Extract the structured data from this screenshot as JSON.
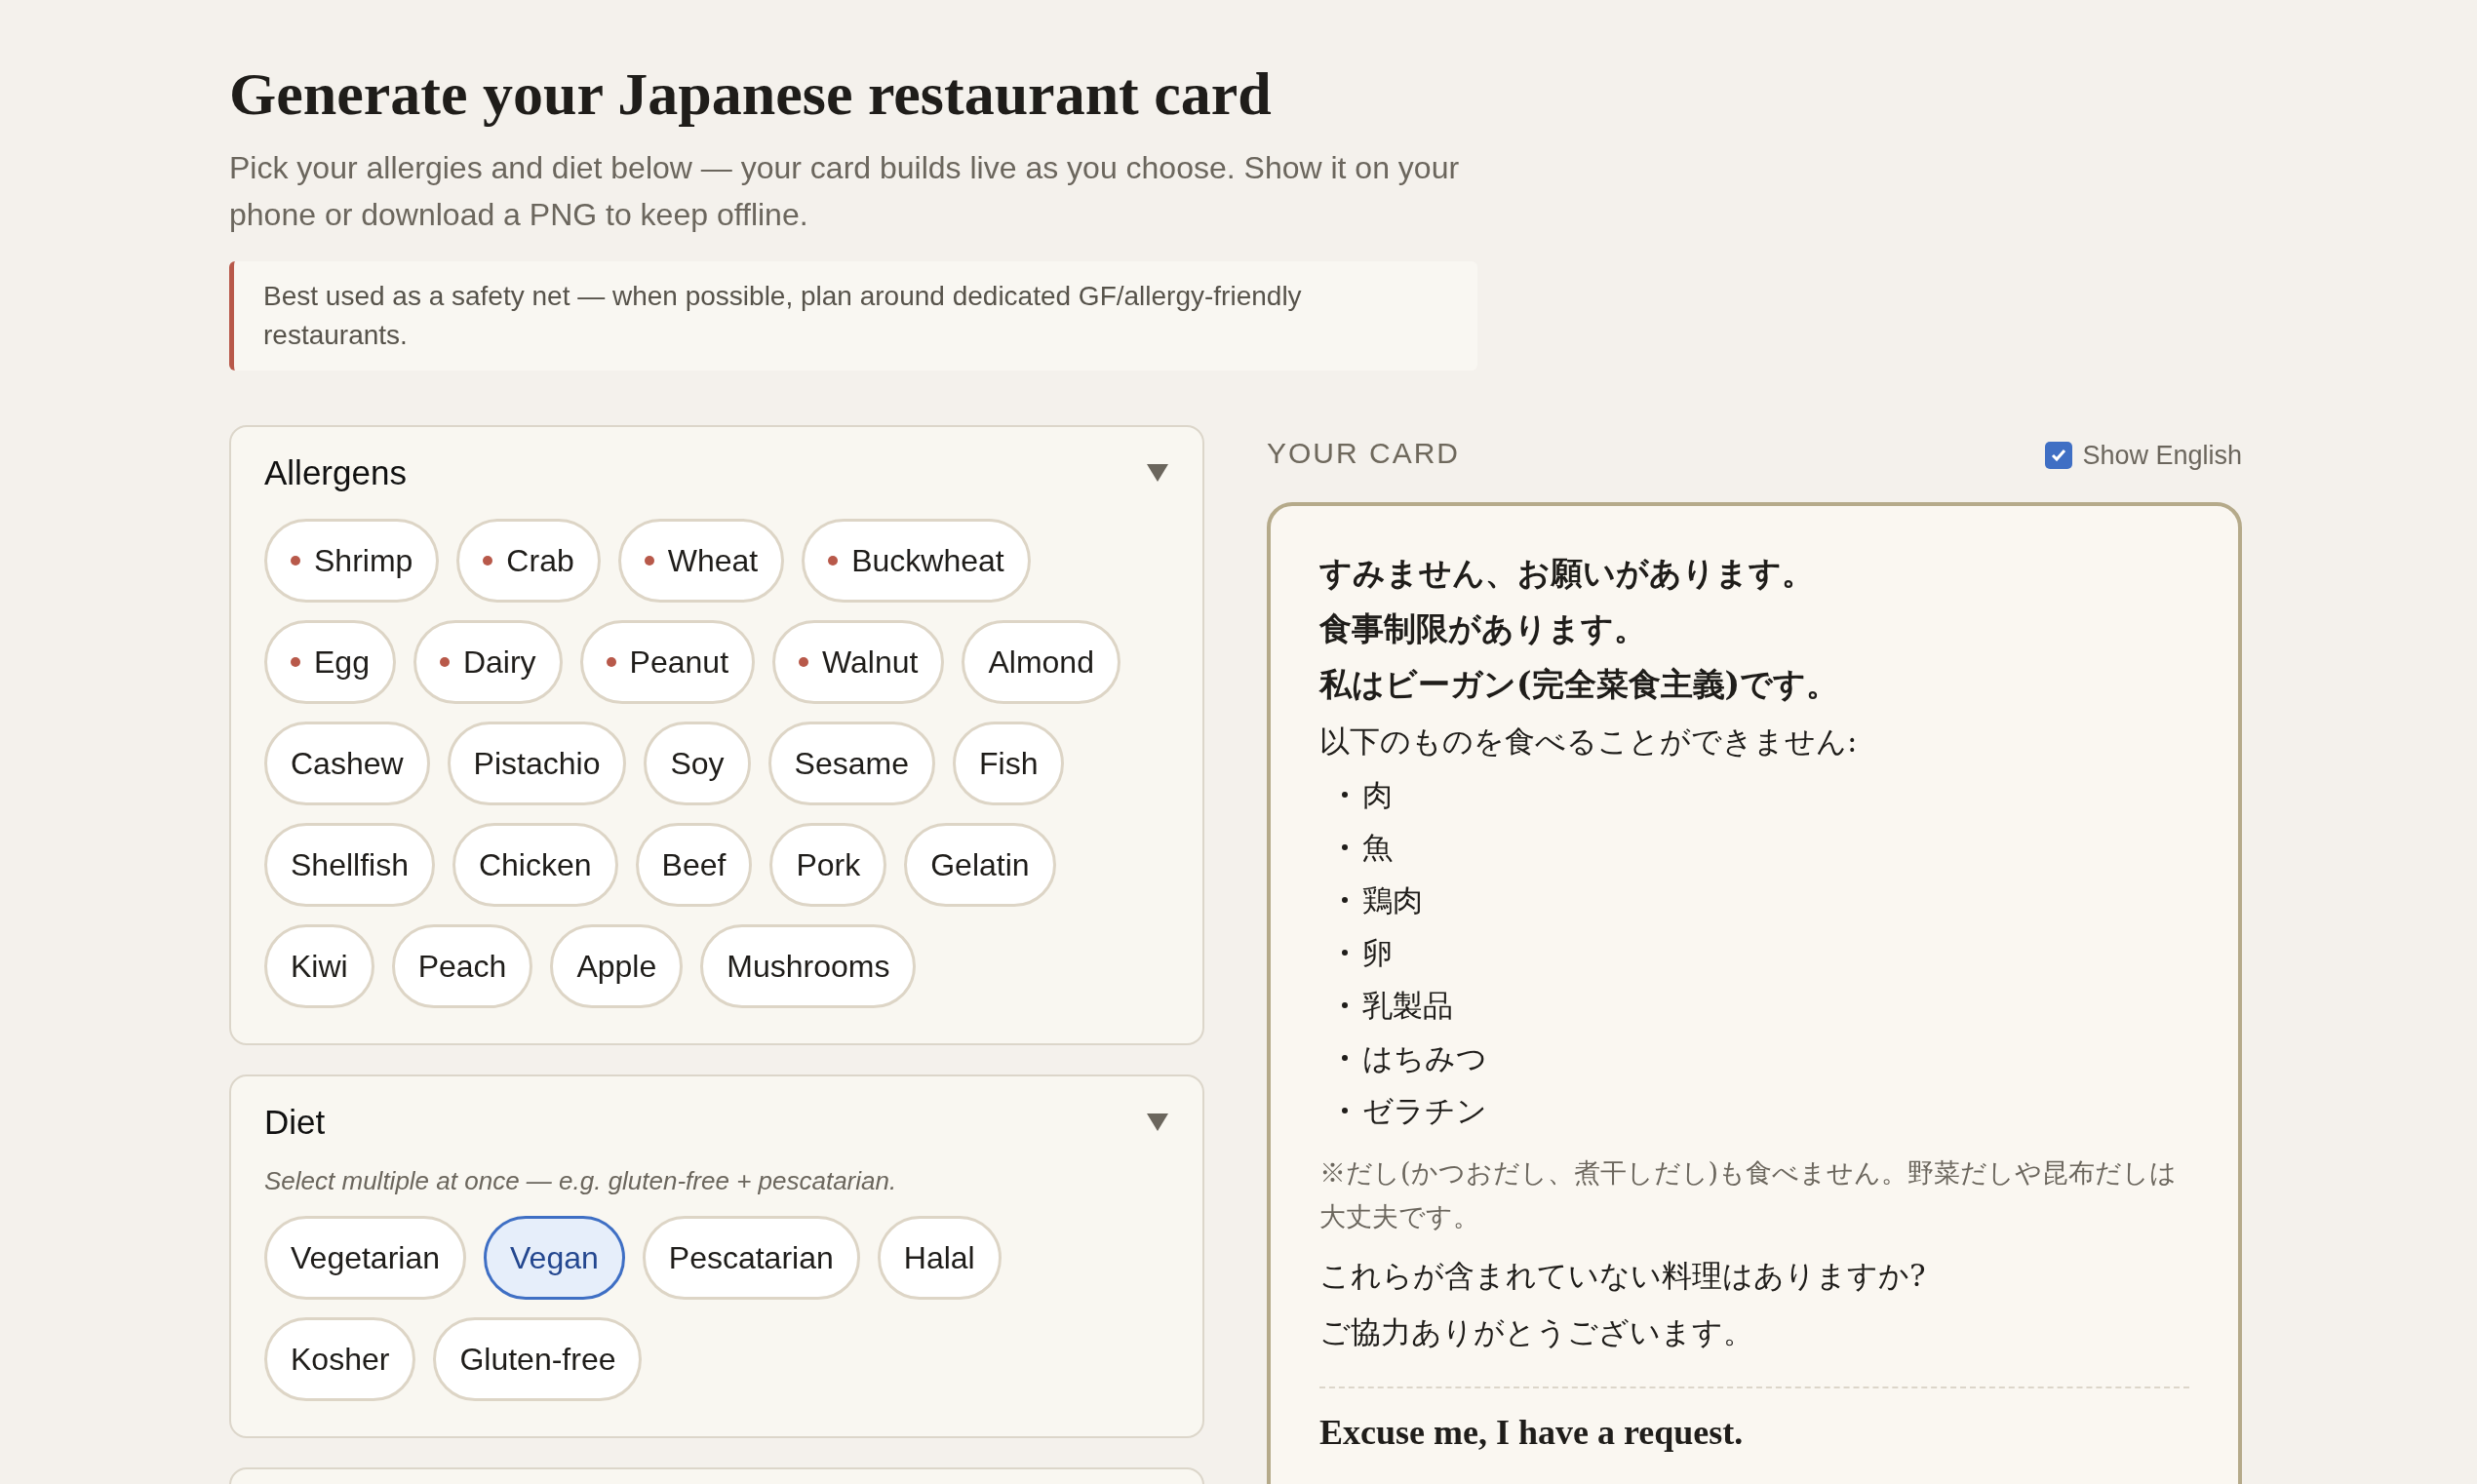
{
  "header": {
    "title": "Generate your Japanese restaurant card",
    "subtitle": "Pick your allergies and diet below — your card builds live as you choose. Show it on your phone or download a PNG to keep offline.",
    "note": "Best used as a safety net — when possible, plan around dedicated GF/allergy-friendly restaurants."
  },
  "allergens": {
    "title": "Allergens",
    "expanded": true,
    "chips": [
      {
        "label": "Shrimp",
        "major": true,
        "selected": false
      },
      {
        "label": "Crab",
        "major": true,
        "selected": false
      },
      {
        "label": "Wheat",
        "major": true,
        "selected": false
      },
      {
        "label": "Buckwheat",
        "major": true,
        "selected": false
      },
      {
        "label": "Egg",
        "major": true,
        "selected": false
      },
      {
        "label": "Dairy",
        "major": true,
        "selected": false
      },
      {
        "label": "Peanut",
        "major": true,
        "selected": false
      },
      {
        "label": "Walnut",
        "major": true,
        "selected": false
      },
      {
        "label": "Almond",
        "major": false,
        "selected": false
      },
      {
        "label": "Cashew",
        "major": false,
        "selected": false
      },
      {
        "label": "Pistachio",
        "major": false,
        "selected": false
      },
      {
        "label": "Soy",
        "major": false,
        "selected": false
      },
      {
        "label": "Sesame",
        "major": false,
        "selected": false
      },
      {
        "label": "Fish",
        "major": false,
        "selected": false
      },
      {
        "label": "Shellfish",
        "major": false,
        "selected": false
      },
      {
        "label": "Chicken",
        "major": false,
        "selected": false
      },
      {
        "label": "Beef",
        "major": false,
        "selected": false
      },
      {
        "label": "Pork",
        "major": false,
        "selected": false
      },
      {
        "label": "Gelatin",
        "major": false,
        "selected": false
      },
      {
        "label": "Kiwi",
        "major": false,
        "selected": false
      },
      {
        "label": "Peach",
        "major": false,
        "selected": false
      },
      {
        "label": "Apple",
        "major": false,
        "selected": false
      },
      {
        "label": "Mushrooms",
        "major": false,
        "selected": false
      }
    ]
  },
  "diet": {
    "title": "Diet",
    "expanded": true,
    "hint": "Select multiple at once — e.g. gluten-free + pescatarian.",
    "chips": [
      {
        "label": "Vegetarian",
        "selected": false
      },
      {
        "label": "Vegan",
        "selected": true
      },
      {
        "label": "Pescatarian",
        "selected": false
      },
      {
        "label": "Halal",
        "selected": false
      },
      {
        "label": "Kosher",
        "selected": false
      },
      {
        "label": "Gluten-free",
        "selected": false
      }
    ]
  },
  "card": {
    "heading": "YOUR CARD",
    "show_english": {
      "label": "Show English",
      "checked": true
    },
    "lines": [
      {
        "kind": "bold",
        "text": "すみません、お願いがあります。"
      },
      {
        "kind": "bold",
        "text": "食事制限があります。"
      },
      {
        "kind": "bold",
        "text": "私はビーガン(完全菜食主義)です。"
      },
      {
        "kind": "plain",
        "text": "以下のものを食べることができません:"
      },
      {
        "kind": "bullet",
        "text": "肉"
      },
      {
        "kind": "bullet",
        "text": "魚"
      },
      {
        "kind": "bullet",
        "text": "鶏肉"
      },
      {
        "kind": "bullet",
        "text": "卵"
      },
      {
        "kind": "bullet",
        "text": "乳製品"
      },
      {
        "kind": "bullet",
        "text": "はちみつ"
      },
      {
        "kind": "bullet",
        "text": "ゼラチン"
      },
      {
        "kind": "note",
        "text": "※だし(かつおだし、煮干しだし)も食べません。野菜だしや昆布だしは大丈夫です。"
      },
      {
        "kind": "plain",
        "text": "これらが含まれていない料理はありますか?"
      },
      {
        "kind": "plain",
        "text": "ご協力ありがとうございます。"
      },
      {
        "kind": "divider"
      },
      {
        "kind": "english",
        "text": "Excuse me, I have a request."
      }
    ]
  }
}
